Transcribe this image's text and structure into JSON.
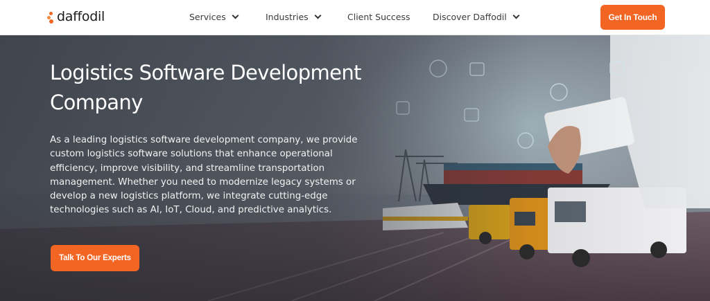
{
  "brand": {
    "name": "daffodil",
    "accent": "#f26522"
  },
  "nav": {
    "items": [
      {
        "label": "Services",
        "dropdown": true
      },
      {
        "label": "Industries",
        "dropdown": true
      },
      {
        "label": "Client Success",
        "dropdown": false
      },
      {
        "label": "Discover Daffodil",
        "dropdown": true
      }
    ],
    "cta_label": "Get In Touch"
  },
  "hero": {
    "title": "Logistics Software Development Company",
    "description": "As a leading logistics software development company, we provide custom logistics software solutions that enhance operational efficiency, improve visibility, and streamline transportation management. Whether you need to modernize legacy systems or develop a new logistics platform, we integrate cutting-edge technologies such as AI, IoT, Cloud, and predictive analytics.",
    "cta_label": "Talk To Our Experts",
    "background_icons": [
      "package-icon",
      "ship-icon",
      "clock-icon",
      "globe-icon",
      "person-icon",
      "box-icon"
    ]
  }
}
